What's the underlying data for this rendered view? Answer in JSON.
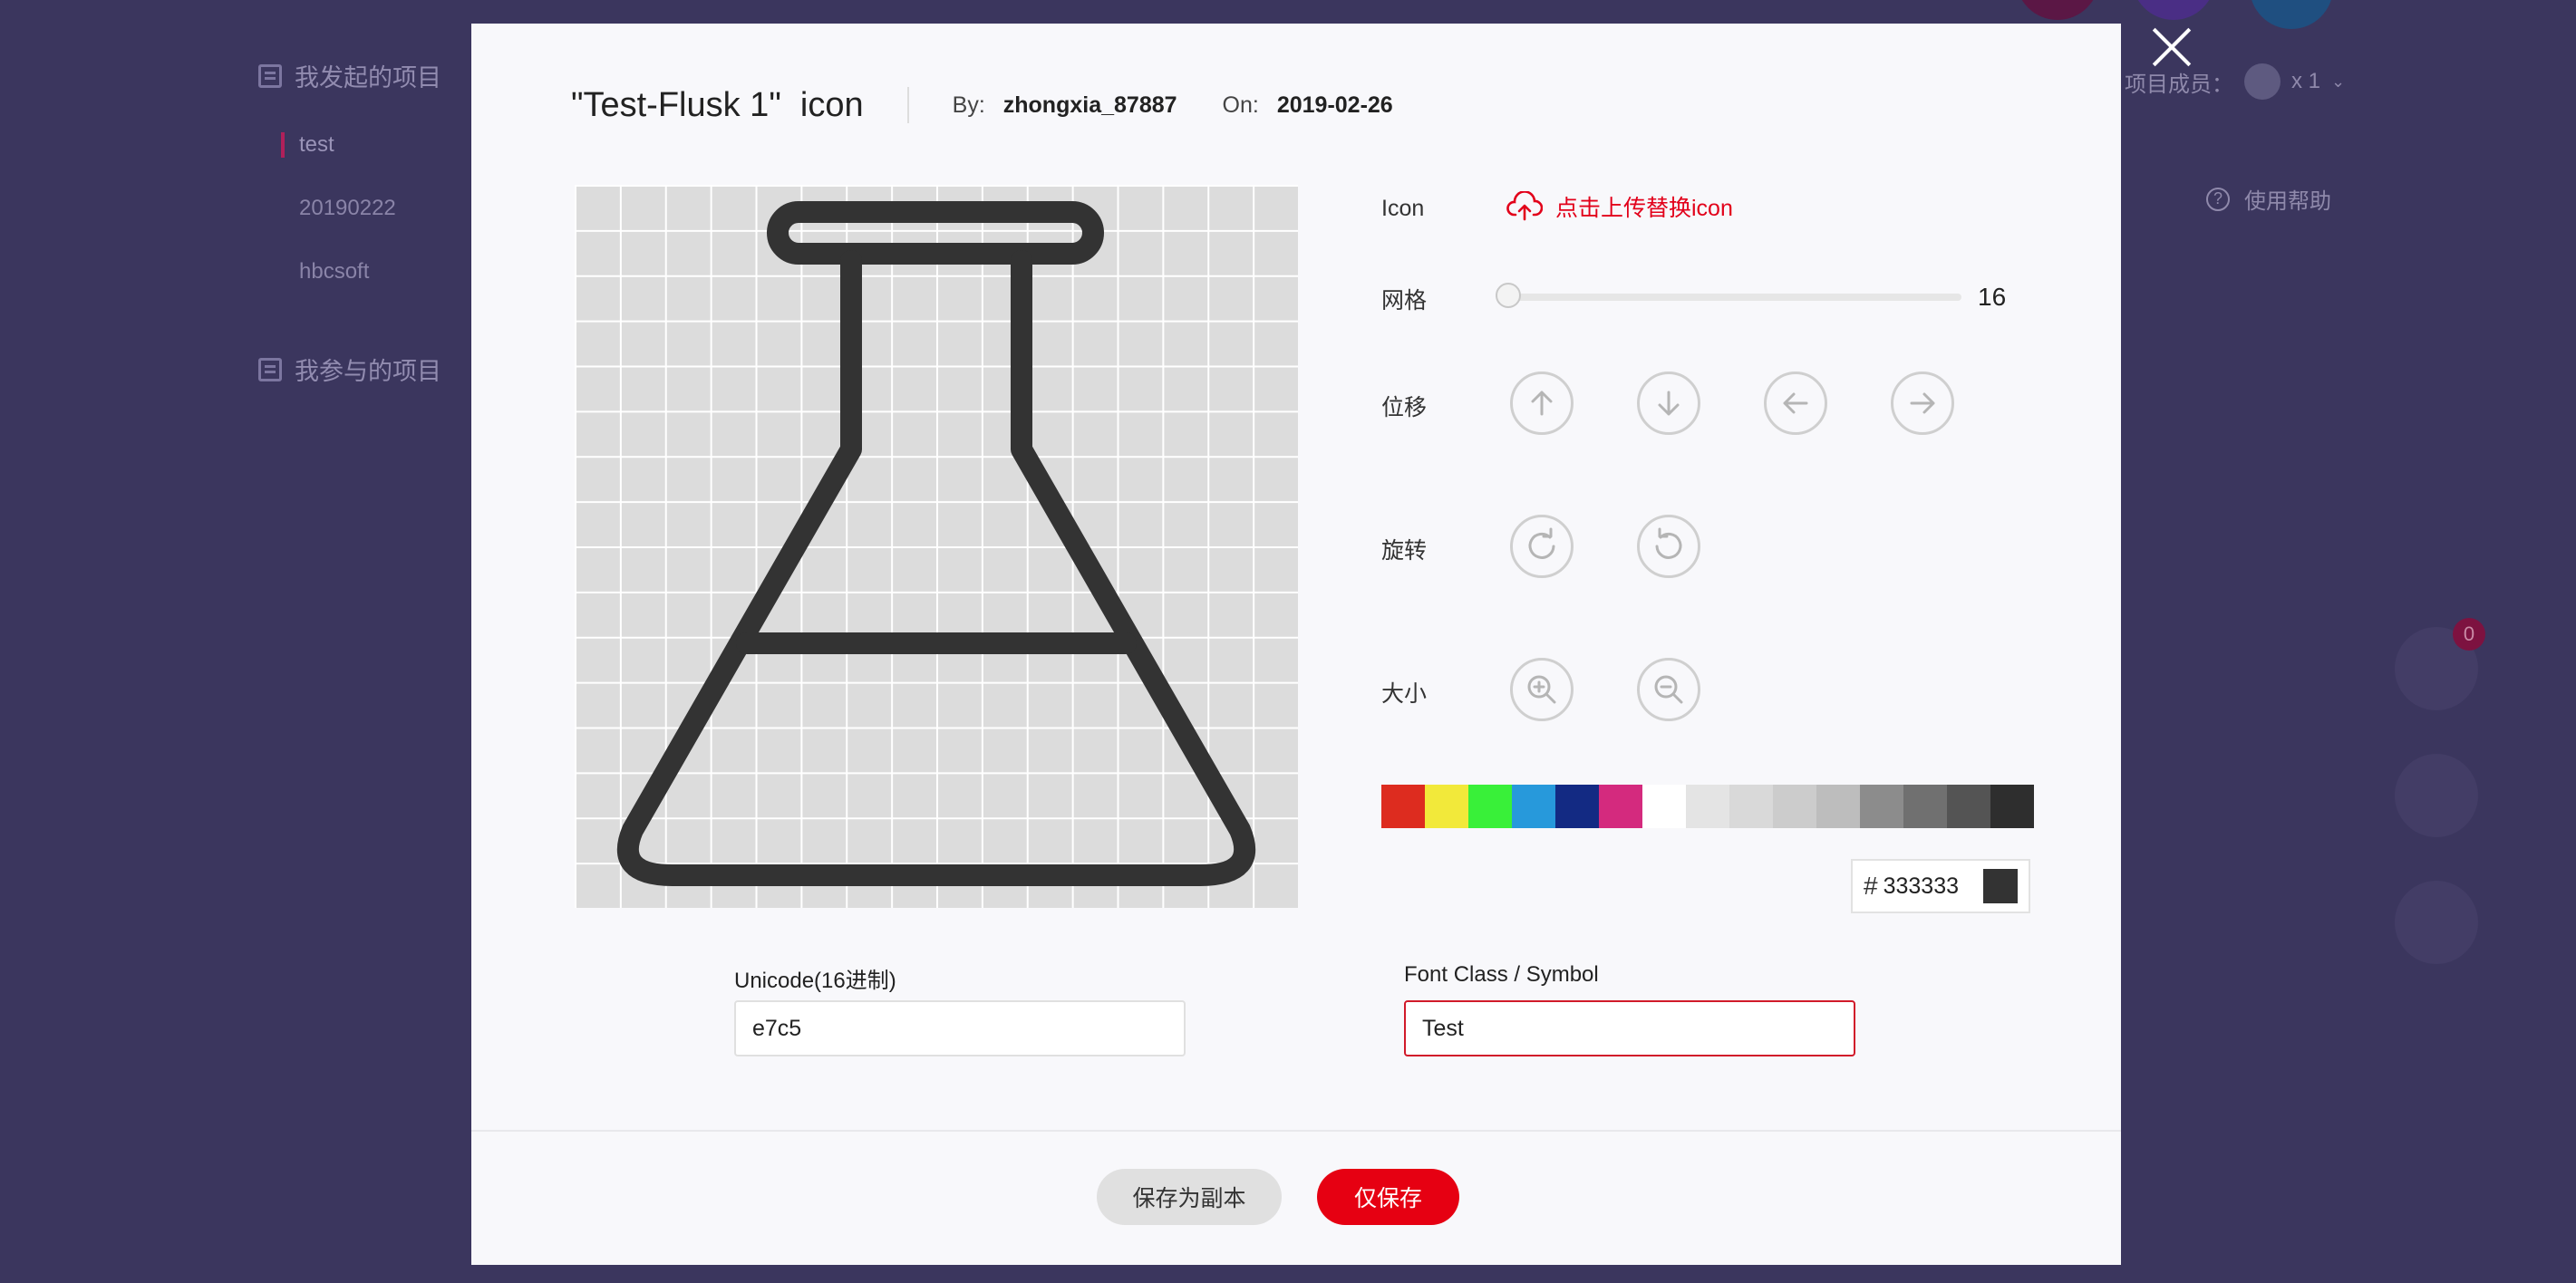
{
  "background": {
    "sidebar": {
      "my_projects": "我发起的项目",
      "projects": [
        "test",
        "20190222",
        "hbcsoft"
      ],
      "joined_projects": "我参与的项目"
    },
    "members": "项目成员：",
    "member_count": "x 1",
    "help": "使用帮助",
    "cart_count": "0"
  },
  "modal": {
    "title": "\"Test-Flusk 1\"  icon",
    "by_label": "By:",
    "author": "zhongxia_87887",
    "on_label": "On:",
    "date": "2019-02-26",
    "icon_label": "Icon",
    "upload_label": "点击上传替换icon",
    "grid_label": "网格",
    "grid_value": "16",
    "grid_level": 0,
    "move_label": "位移",
    "rotate_label": "旋转",
    "size_label": "大小",
    "swatches": [
      "#dd2c1f",
      "#f2e93a",
      "#39f039",
      "#2799db",
      "#132a83",
      "#d42a7e",
      "#ffffff",
      "#e4e4e4",
      "#d9d9d9",
      "#cccccc",
      "#bdbdbd",
      "#8c8c8c",
      "#707070",
      "#545454",
      "#2e2e2e"
    ],
    "color_hash": "#",
    "color_value": "333333",
    "color_hex": "#333333",
    "unicode_label": "Unicode(16进制)",
    "unicode_value": "e7c5",
    "fontclass_label": "Font Class / Symbol",
    "fontclass_value": "Test",
    "save_copy": "保存为副本",
    "save_only": "仅保存"
  }
}
